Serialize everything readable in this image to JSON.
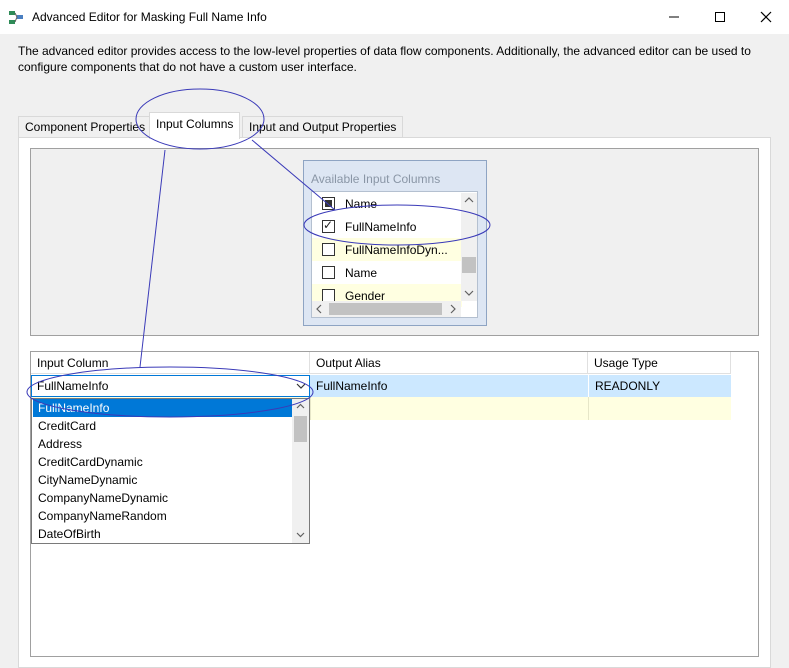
{
  "window": {
    "title": "Advanced Editor for Masking Full Name Info"
  },
  "description": "The advanced editor provides access to the low-level properties of data flow components. Additionally, the advanced editor can be used to configure components that do not have a custom user interface.",
  "tabs": [
    {
      "label": "Component Properties"
    },
    {
      "label": "Input Columns"
    },
    {
      "label": "Input and Output Properties"
    }
  ],
  "available": {
    "title": "Available Input Columns",
    "rows": [
      {
        "label": "Name",
        "state": "mixed"
      },
      {
        "label": "FullNameInfo",
        "state": "checked"
      },
      {
        "label": "FullNameInfoDyn...",
        "state": "unchecked"
      },
      {
        "label": "Name",
        "state": "unchecked"
      },
      {
        "label": "Gender",
        "state": "unchecked"
      }
    ]
  },
  "grid": {
    "headers": {
      "input_column": "Input Column",
      "output_alias": "Output Alias",
      "usage_type": "Usage Type"
    },
    "row1": {
      "input_column": "FullNameInfo",
      "output_alias": "FullNameInfo",
      "usage_type": "READONLY"
    }
  },
  "dropdown": {
    "items": [
      "FullNameInfo",
      "CreditCard",
      "Address",
      "CreditCardDynamic",
      "CityNameDynamic",
      "CompanyNameDynamic",
      "CompanyNameRandom",
      "DateOfBirth"
    ],
    "selected": "FullNameInfo"
  },
  "colors": {
    "accent": "#0078d7",
    "selection_row": "#cce8ff",
    "highlight_row": "#ffffe1",
    "annotation": "#3a3ab8"
  }
}
